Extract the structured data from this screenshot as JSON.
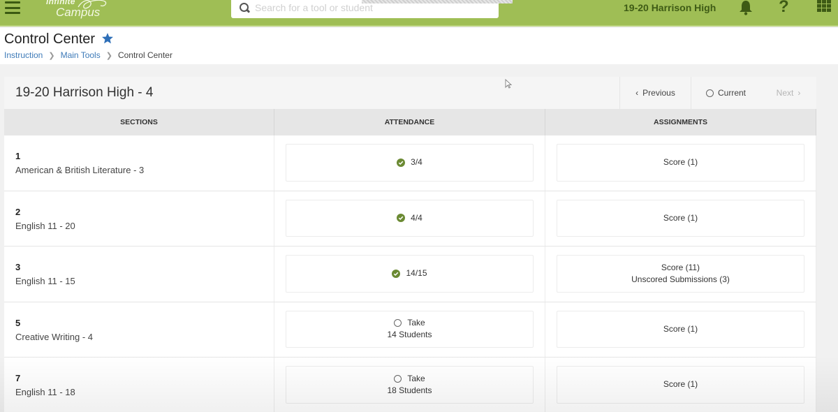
{
  "topbar": {
    "logo_line1": "Infinite",
    "logo_line2": "Campus",
    "search_placeholder": "Search for a tool or student",
    "search_value": "",
    "school": "19-20 Harrison High",
    "help_label": "?",
    "icons": [
      "menu-icon",
      "search-icon",
      "bell-icon",
      "help-icon",
      "apps-grid-icon"
    ],
    "brand_color": "#9fbe55"
  },
  "page": {
    "title": "Control Center",
    "favorite_icon": "star-icon",
    "breadcrumb": [
      {
        "label": "Instruction",
        "link": true
      },
      {
        "label": "Main Tools",
        "link": true
      },
      {
        "label": "Control Center",
        "link": false
      }
    ]
  },
  "panel": {
    "title": "19-20 Harrison High - 4",
    "nav": {
      "previous": "Previous",
      "current": "Current",
      "next": "Next"
    },
    "columns": [
      "SECTIONS",
      "ATTENDANCE",
      "ASSIGNMENTS"
    ],
    "rows": [
      {
        "period": "1",
        "section": "American & British Literature - 3",
        "attendance": {
          "status": "taken",
          "line1": "3/4",
          "line2": ""
        },
        "assignments": {
          "line1": "Score (1)",
          "line2": ""
        }
      },
      {
        "period": "2",
        "section": "English 11 - 20",
        "attendance": {
          "status": "taken",
          "line1": "4/4",
          "line2": ""
        },
        "assignments": {
          "line1": "Score (1)",
          "line2": ""
        }
      },
      {
        "period": "3",
        "section": "English 11 - 15",
        "attendance": {
          "status": "taken",
          "line1": "14/15",
          "line2": ""
        },
        "assignments": {
          "line1": "Score (11)",
          "line2": "Unscored Submissions (3)"
        }
      },
      {
        "period": "5",
        "section": "Creative Writing - 4",
        "attendance": {
          "status": "not-taken",
          "line1": "Take",
          "line2": "14 Students"
        },
        "assignments": {
          "line1": "Score (1)",
          "line2": ""
        }
      },
      {
        "period": "7",
        "section": "English 11 - 18",
        "attendance": {
          "status": "not-taken",
          "line1": "Take",
          "line2": "18 Students"
        },
        "assignments": {
          "line1": "Score (1)",
          "line2": ""
        }
      }
    ],
    "status_colors": {
      "taken": "#6b8a33"
    }
  }
}
